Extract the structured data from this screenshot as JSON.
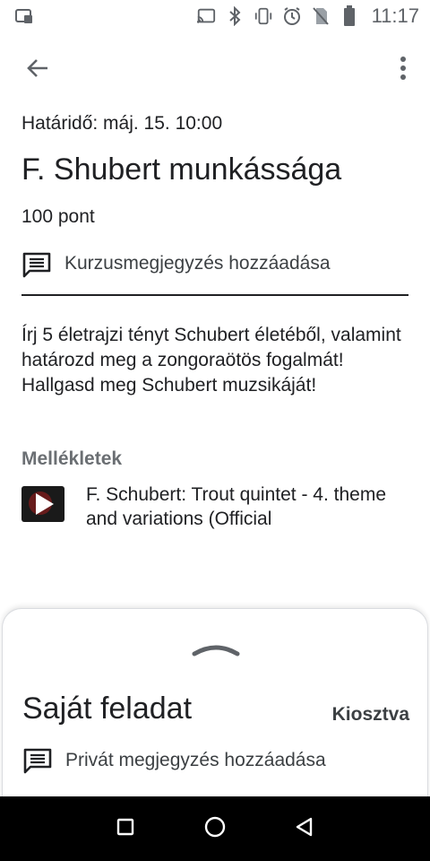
{
  "status_bar": {
    "time": "11:17",
    "icons": [
      "screenshot-icon",
      "cast-icon",
      "bluetooth-icon",
      "vibrate-icon",
      "alarm-icon",
      "no-sim-icon",
      "battery-icon"
    ]
  },
  "app_bar": {
    "back_icon": "arrow-back-icon",
    "more_icon": "more-vert-icon"
  },
  "assignment": {
    "due": "Határidő: máj. 15. 10:00",
    "title": "F. Shubert munkássága",
    "points": "100 pont",
    "class_comment": "Kurzusmegjegyzés hozzáadása",
    "description": "Írj 5 életrajzi tényt Schubert életéből, valamint határozd meg a zongoraötös fogalmát! Hallgasd meg Schubert muzsikáját!",
    "attachments_label": "Mellékletek",
    "attachments": [
      {
        "title": "F. Schubert: Trout quintet - 4. theme and variations (Official"
      }
    ]
  },
  "sheet": {
    "title": "Saját feladat",
    "status": "Kiosztva",
    "private_comment": "Privát megjegyzés hozzáadása"
  },
  "nav_bar": {
    "icons": [
      "recents-square-icon",
      "home-circle-icon",
      "back-triangle-icon"
    ]
  },
  "colors": {
    "text": "#202124",
    "secondary_text": "#3c4043",
    "label": "#6b6f73",
    "nav_bg": "#000000"
  }
}
